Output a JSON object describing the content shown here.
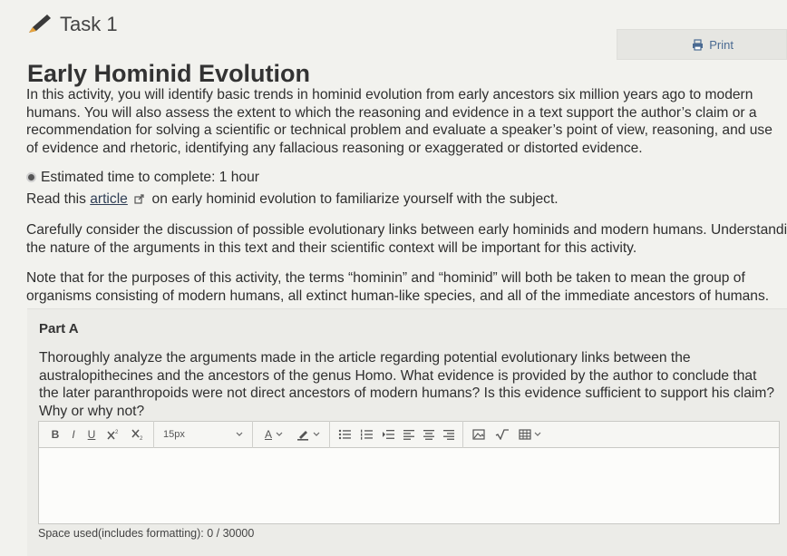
{
  "task": {
    "label": "Task 1"
  },
  "print": {
    "label": "Print"
  },
  "title": "Early Hominid Evolution",
  "intro": "In this activity, you will identify basic trends in hominid evolution from early ancestors six million years ago to modern humans. You will also assess the extent to which the reasoning and evidence in a text support the author’s claim or a recommendation for solving a scientific or technical problem and evaluate a speaker’s point of view, reasoning, and use of evidence and rhetoric, identifying any fallacious reasoning or exaggerated or distorted evidence.",
  "estimate": "Estimated time to complete: 1 hour",
  "read": {
    "prefix": "Read this",
    "link": "article",
    "suffix": "on early hominid evolution to familiarize yourself with the subject."
  },
  "consider": {
    "line1": "Carefully consider the discussion of possible evolutionary links between early hominids and modern humans. Understanding",
    "line2": "the nature of the arguments in this text and their scientific context will be important for this activity."
  },
  "note": "Note that for the purposes of this activity, the terms “hominin” and “hominid” will both be taken to mean the group of organisms consisting of modern humans, all extinct human-like species, and all of the immediate ancestors of humans.",
  "part_a": {
    "title": "Part A",
    "question": "Thoroughly analyze the arguments made in the article regarding potential evolutionary links between the australopithecines and the ancestors of the genus Homo. What evidence is provided by the author to conclude that the later paranthropoids were not direct ancestors of modern humans? Is this evidence sufficient to support his claim? Why or why not?"
  },
  "toolbar": {
    "bold": "B",
    "italic": "I",
    "underline": "U",
    "font_size": "15px",
    "font_color": "A"
  },
  "editor": {
    "value": ""
  },
  "space_used": "Space used(includes formatting): 0 / 30000",
  "colors": {
    "link": "#4a6a92",
    "panel": "#ececE8",
    "pencil": "#3a3a3a",
    "pencil_tip": "#e8a33a"
  }
}
